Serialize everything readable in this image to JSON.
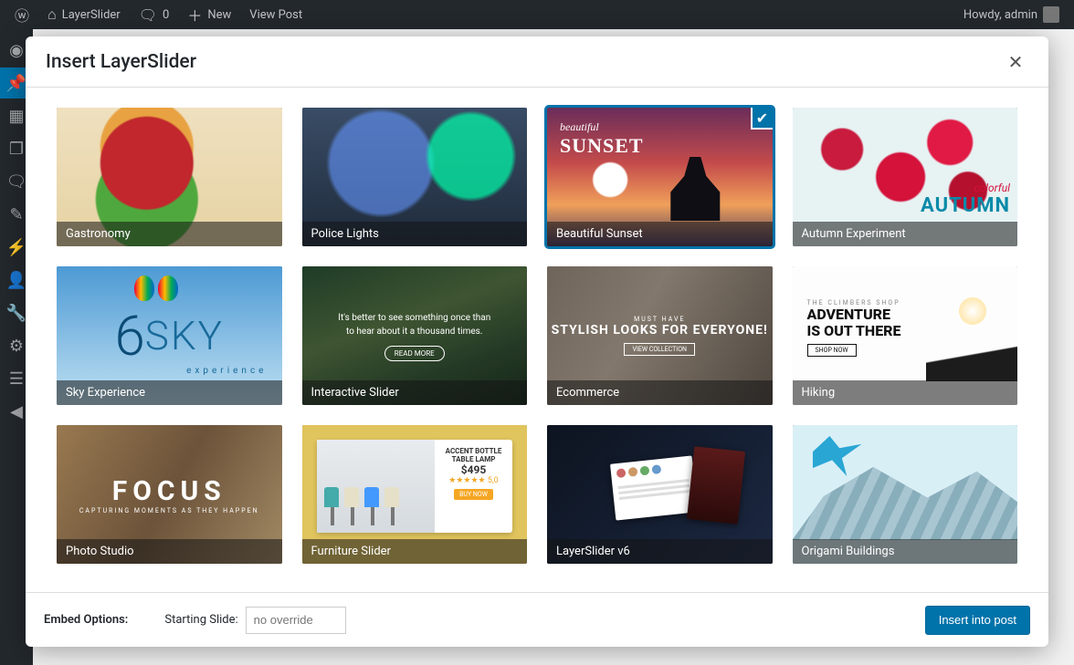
{
  "adminbar": {
    "site_name": "LayerSlider",
    "comments_count": "0",
    "new_label": "New",
    "view_post": "View Post",
    "howdy": "Howdy, admin"
  },
  "modal": {
    "title": "Insert LayerSlider"
  },
  "tiles": [
    {
      "label": "Gastronomy"
    },
    {
      "label": "Police Lights"
    },
    {
      "label": "Beautiful Sunset",
      "selected": true,
      "accent": {
        "small": "beautiful",
        "big": "SUNSET"
      }
    },
    {
      "label": "Autumn Experiment",
      "accent": {
        "small": "colorful",
        "big": "AUTUMN"
      }
    },
    {
      "label": "Sky Experience",
      "accent": {
        "six": "6",
        "sky": "SKY",
        "exp": "experience"
      }
    },
    {
      "label": "Interactive Slider",
      "accent": {
        "line": "It's better to see something once than to hear about it a thousand times.",
        "btn": "READ MORE"
      }
    },
    {
      "label": "Ecommerce",
      "accent": {
        "must": "MUST HAVE",
        "big": "STYLISH LOOKS FOR EVERYONE!",
        "btn": "VIEW COLLECTION"
      }
    },
    {
      "label": "Hiking",
      "accent": {
        "s": "THE CLIMBERS SHOP",
        "b1": "ADVENTURE",
        "b2": "IS OUT THERE",
        "btn": "SHOP NOW"
      }
    },
    {
      "label": "Photo Studio",
      "accent": {
        "f": "FOCUS",
        "s": "CAPTURING MOMENTS AS THEY HAPPEN"
      }
    },
    {
      "label": "Furniture Slider",
      "accent": {
        "t1": "ACCENT BOTTLE",
        "t2": "TABLE LAMP",
        "p": "$495",
        "r": "5,0",
        "buy": "BUY NOW"
      }
    },
    {
      "label": "LayerSlider v6"
    },
    {
      "label": "Origami Buildings"
    }
  ],
  "footer": {
    "embed_label": "Embed Options:",
    "starting_label": "Starting Slide:",
    "starting_placeholder": "no override",
    "submit": "Insert into post"
  }
}
